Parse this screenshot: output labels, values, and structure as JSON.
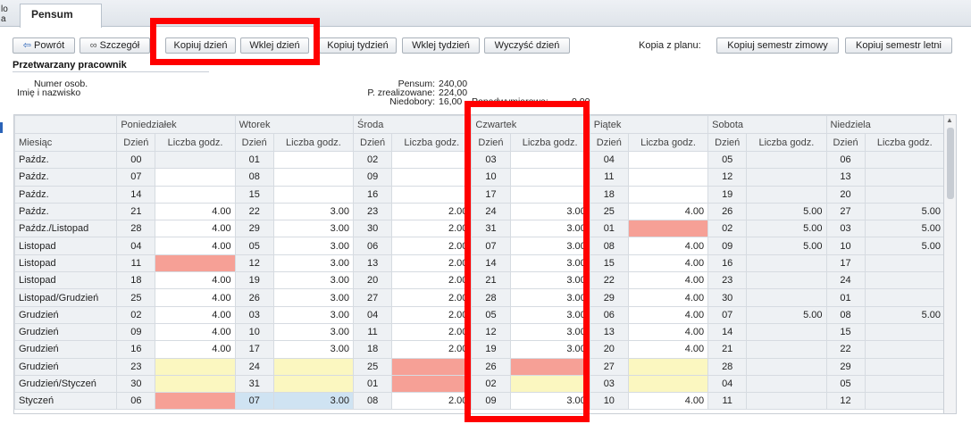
{
  "tabs": {
    "left_stub": [
      "lo",
      "a"
    ],
    "active": "Pensum"
  },
  "toolbar": {
    "back": "Powrót",
    "details": "Szczegół",
    "copy_day": "Kopiuj dzień",
    "paste_day": "Wklej dzień",
    "copy_week": "Kopiuj tydzień",
    "paste_week": "Wklej tydzień",
    "clear_day": "Wyczyść dzień",
    "copy_from_plan_label": "Kopia z planu:",
    "copy_winter": "Kopiuj semestr zimowy",
    "copy_summer": "Kopiuj semestr letni"
  },
  "worker": {
    "section_title": "Przetwarzany pracownik",
    "employee_no_label": "Numer osob.",
    "name_label": "Imię i nazwisko",
    "pensum_label": "Pensum:",
    "pensum_value": "240,00",
    "realized_label": "P. zrealizowane:",
    "realized_value": "224,00",
    "shortfall_label": "Niedobory:",
    "shortfall_value": "16,00",
    "overtime_label": "Ponadwymiarowe:",
    "overtime_value": "0,00"
  },
  "grid": {
    "month_header": "Miesiąc",
    "day_header": "Dzień",
    "hours_header": "Liczba godz.",
    "weekdays": [
      "Poniedziałek",
      "Wtorek",
      "Środa",
      "Czwartek",
      "Piątek",
      "Sobota",
      "Niedziela"
    ],
    "rows": [
      {
        "month": "Paźdz.",
        "cells": [
          [
            "00",
            "",
            "gray"
          ],
          [
            "01",
            "",
            ""
          ],
          [
            "02",
            "",
            ""
          ],
          [
            "03",
            "",
            ""
          ],
          [
            "04",
            "",
            ""
          ],
          [
            "05",
            "",
            "gray"
          ],
          [
            "06",
            "",
            "gray"
          ]
        ]
      },
      {
        "month": "Paźdz.",
        "cells": [
          [
            "07",
            "",
            ""
          ],
          [
            "08",
            "",
            ""
          ],
          [
            "09",
            "",
            ""
          ],
          [
            "10",
            "",
            ""
          ],
          [
            "11",
            "",
            ""
          ],
          [
            "12",
            "",
            "gray"
          ],
          [
            "13",
            "",
            "gray"
          ]
        ]
      },
      {
        "month": "Paźdz.",
        "cells": [
          [
            "14",
            "",
            ""
          ],
          [
            "15",
            "",
            ""
          ],
          [
            "16",
            "",
            ""
          ],
          [
            "17",
            "",
            ""
          ],
          [
            "18",
            "",
            ""
          ],
          [
            "19",
            "",
            "gray"
          ],
          [
            "20",
            "",
            "gray"
          ]
        ]
      },
      {
        "month": "Paźdz.",
        "cells": [
          [
            "21",
            "4.00",
            ""
          ],
          [
            "22",
            "3.00",
            ""
          ],
          [
            "23",
            "2.00",
            ""
          ],
          [
            "24",
            "3.00",
            ""
          ],
          [
            "25",
            "4.00",
            ""
          ],
          [
            "26",
            "5.00",
            "gray"
          ],
          [
            "27",
            "5.00",
            "gray"
          ]
        ]
      },
      {
        "month": "Paźdz./Listopad",
        "cells": [
          [
            "28",
            "4.00",
            ""
          ],
          [
            "29",
            "3.00",
            ""
          ],
          [
            "30",
            "2.00",
            ""
          ],
          [
            "31",
            "3.00",
            ""
          ],
          [
            "01",
            "",
            "red"
          ],
          [
            "02",
            "5.00",
            "gray"
          ],
          [
            "03",
            "5.00",
            "gray"
          ]
        ]
      },
      {
        "month": "Listopad",
        "cells": [
          [
            "04",
            "4.00",
            ""
          ],
          [
            "05",
            "3.00",
            ""
          ],
          [
            "06",
            "2.00",
            ""
          ],
          [
            "07",
            "3.00",
            ""
          ],
          [
            "08",
            "4.00",
            ""
          ],
          [
            "09",
            "5.00",
            "gray"
          ],
          [
            "10",
            "5.00",
            "gray"
          ]
        ]
      },
      {
        "month": "Listopad",
        "cells": [
          [
            "11",
            "",
            "red"
          ],
          [
            "12",
            "3.00",
            ""
          ],
          [
            "13",
            "2.00",
            ""
          ],
          [
            "14",
            "3.00",
            ""
          ],
          [
            "15",
            "4.00",
            ""
          ],
          [
            "16",
            "",
            "gray"
          ],
          [
            "17",
            "",
            "gray"
          ]
        ]
      },
      {
        "month": "Listopad",
        "cells": [
          [
            "18",
            "4.00",
            ""
          ],
          [
            "19",
            "3.00",
            ""
          ],
          [
            "20",
            "2.00",
            ""
          ],
          [
            "21",
            "3.00",
            ""
          ],
          [
            "22",
            "4.00",
            ""
          ],
          [
            "23",
            "",
            "gray"
          ],
          [
            "24",
            "",
            "gray"
          ]
        ]
      },
      {
        "month": "Listopad/Grudzień",
        "cells": [
          [
            "25",
            "4.00",
            ""
          ],
          [
            "26",
            "3.00",
            ""
          ],
          [
            "27",
            "2.00",
            ""
          ],
          [
            "28",
            "3.00",
            ""
          ],
          [
            "29",
            "4.00",
            ""
          ],
          [
            "30",
            "",
            "gray"
          ],
          [
            "01",
            "",
            "gray"
          ]
        ]
      },
      {
        "month": "Grudzień",
        "cells": [
          [
            "02",
            "4.00",
            ""
          ],
          [
            "03",
            "3.00",
            ""
          ],
          [
            "04",
            "2.00",
            ""
          ],
          [
            "05",
            "3.00",
            ""
          ],
          [
            "06",
            "4.00",
            ""
          ],
          [
            "07",
            "5.00",
            "gray"
          ],
          [
            "08",
            "5.00",
            "gray"
          ]
        ]
      },
      {
        "month": "Grudzień",
        "cells": [
          [
            "09",
            "4.00",
            ""
          ],
          [
            "10",
            "3.00",
            ""
          ],
          [
            "11",
            "2.00",
            ""
          ],
          [
            "12",
            "3.00",
            ""
          ],
          [
            "13",
            "4.00",
            ""
          ],
          [
            "14",
            "",
            "gray"
          ],
          [
            "15",
            "",
            "gray"
          ]
        ]
      },
      {
        "month": "Grudzień",
        "cells": [
          [
            "16",
            "4.00",
            ""
          ],
          [
            "17",
            "3.00",
            ""
          ],
          [
            "18",
            "2.00",
            ""
          ],
          [
            "19",
            "3.00",
            ""
          ],
          [
            "20",
            "4.00",
            ""
          ],
          [
            "21",
            "",
            "gray"
          ],
          [
            "22",
            "",
            "gray"
          ]
        ]
      },
      {
        "month": "Grudzień",
        "cells": [
          [
            "23",
            "",
            "yellow"
          ],
          [
            "24",
            "",
            "yellow"
          ],
          [
            "25",
            "",
            "red"
          ],
          [
            "26",
            "",
            "red"
          ],
          [
            "27",
            "",
            "yellow"
          ],
          [
            "28",
            "",
            "gray"
          ],
          [
            "29",
            "",
            "gray"
          ]
        ]
      },
      {
        "month": "Grudzień/Styczeń",
        "cells": [
          [
            "30",
            "",
            "yellow"
          ],
          [
            "31",
            "",
            "yellow"
          ],
          [
            "01",
            "",
            "red"
          ],
          [
            "02",
            "",
            "yellow"
          ],
          [
            "03",
            "",
            "yellow"
          ],
          [
            "04",
            "",
            "gray"
          ],
          [
            "05",
            "",
            "gray"
          ]
        ]
      },
      {
        "month": "Styczeń",
        "cells": [
          [
            "06",
            "",
            "red"
          ],
          [
            "07",
            "3.00",
            "blue"
          ],
          [
            "08",
            "2.00",
            ""
          ],
          [
            "09",
            "3.00",
            ""
          ],
          [
            "10",
            "4.00",
            ""
          ],
          [
            "11",
            "",
            "gray"
          ],
          [
            "12",
            "",
            "gray"
          ]
        ]
      }
    ]
  },
  "colors": {
    "red_fill": "#f6a096",
    "yellow_fill": "#fbf7c0",
    "blue_fill": "#cfe3f2",
    "annotation_red": "#ff0000",
    "header_bg": "#eef1f4"
  },
  "icons": {
    "back": "arrow-left-icon",
    "details": "glasses-icon"
  }
}
